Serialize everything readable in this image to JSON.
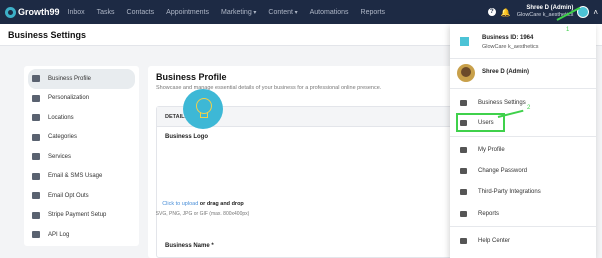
{
  "topbar": {
    "logo_text": "Growth99",
    "nav": [
      {
        "label": "Inbox",
        "has_caret": false
      },
      {
        "label": "Tasks",
        "has_caret": false
      },
      {
        "label": "Contacts",
        "has_caret": false
      },
      {
        "label": "Appointments",
        "has_caret": false
      },
      {
        "label": "Marketing",
        "has_caret": true
      },
      {
        "label": "Content",
        "has_caret": true
      },
      {
        "label": "Automations",
        "has_caret": false
      },
      {
        "label": "Reports",
        "has_caret": false
      }
    ],
    "help_glyph": "?",
    "bell_glyph": "🔔",
    "user_name": "Shree D (Admin)",
    "user_business": "GlowCare k_aesthetics",
    "chevron_glyph": "˄"
  },
  "page": {
    "title": "Business Settings"
  },
  "sidebar": {
    "items": [
      {
        "label": "Business Profile",
        "icon": "business-profile-icon",
        "active": true
      },
      {
        "label": "Personalization",
        "icon": "personalization-icon",
        "active": false
      },
      {
        "label": "Locations",
        "icon": "locations-icon",
        "active": false
      },
      {
        "label": "Categories",
        "icon": "categories-icon",
        "active": false
      },
      {
        "label": "Services",
        "icon": "services-icon",
        "active": false
      },
      {
        "label": "Email & SMS Usage",
        "icon": "email-sms-icon",
        "active": false
      },
      {
        "label": "Email Opt Outs",
        "icon": "email-opt-out-icon",
        "active": false
      },
      {
        "label": "Stripe Payment Setup",
        "icon": "stripe-icon",
        "active": false
      },
      {
        "label": "API Log",
        "icon": "api-log-icon",
        "active": false
      }
    ]
  },
  "main": {
    "title": "Business Profile",
    "subtitle": "Showcase and manage essential details of your business for a professional online presence.",
    "details_heading": "DETAILS",
    "logo_label": "Business Logo",
    "upload_click": "Click to upload",
    "upload_rest": " or drag and drop",
    "upload_hint": "SVG, PNG, JPG or GIF (max. 800x400px)",
    "name_label": "Business Name *"
  },
  "dropdown": {
    "business_id": "Business ID: 1964",
    "business_name": "GlowCare k_aesthetics",
    "user_name": "Shree D (Admin)",
    "items": [
      {
        "label": "Business Settings",
        "icon": "business-settings-icon"
      },
      {
        "label": "Users",
        "icon": "users-icon"
      },
      {
        "label": "My Profile",
        "icon": "my-profile-icon"
      },
      {
        "label": "Change Password",
        "icon": "lock-icon"
      },
      {
        "label": "Third-Party Integrations",
        "icon": "integrations-icon"
      },
      {
        "label": "Reports",
        "icon": "reports-icon"
      },
      {
        "label": "Help Center",
        "icon": "help-icon"
      }
    ]
  },
  "annotations": {
    "step1": "1",
    "step2": "2",
    "highlight_color": "#3fd14b"
  },
  "colors": {
    "navbar": "#1d2a44",
    "accent": "#3db8d6",
    "active_item": "#e8ecef"
  }
}
